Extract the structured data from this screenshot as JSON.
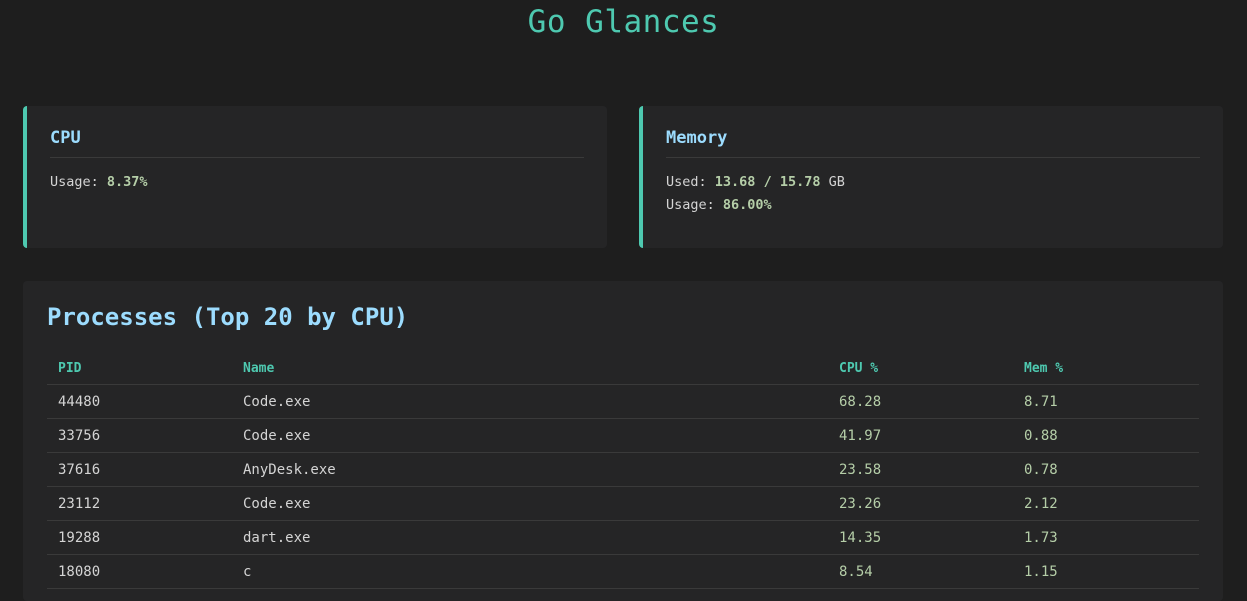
{
  "header": {
    "title": "Go Glances"
  },
  "cpu": {
    "title": "CPU",
    "usage_label": "Usage:",
    "usage_value": "8.37%"
  },
  "memory": {
    "title": "Memory",
    "used_label": "Used:",
    "used_value": "13.68",
    "separator": "/",
    "total_value": "15.78",
    "unit": "GB",
    "usage_label": "Usage:",
    "usage_value": "86.00%"
  },
  "processes": {
    "title": "Processes (Top 20 by CPU)",
    "columns": [
      "PID",
      "Name",
      "CPU %",
      "Mem %"
    ],
    "rows": [
      {
        "pid": "44480",
        "name": "Code.exe",
        "cpu": "68.28",
        "mem": "8.71"
      },
      {
        "pid": "33756",
        "name": "Code.exe",
        "cpu": "41.97",
        "mem": "0.88"
      },
      {
        "pid": "37616",
        "name": "AnyDesk.exe",
        "cpu": "23.58",
        "mem": "0.78"
      },
      {
        "pid": "23112",
        "name": "Code.exe",
        "cpu": "23.26",
        "mem": "2.12"
      },
      {
        "pid": "19288",
        "name": "dart.exe",
        "cpu": "14.35",
        "mem": "1.73"
      },
      {
        "pid": "18080",
        "name": "c",
        "cpu": "8.54",
        "mem": "1.15"
      }
    ]
  },
  "colors": {
    "background": "#1e1e1e",
    "card": "#252526",
    "accent": "#4ec9b0",
    "heading": "#9cdcfe",
    "value": "#b5cea8",
    "text": "#d4d4d4"
  }
}
